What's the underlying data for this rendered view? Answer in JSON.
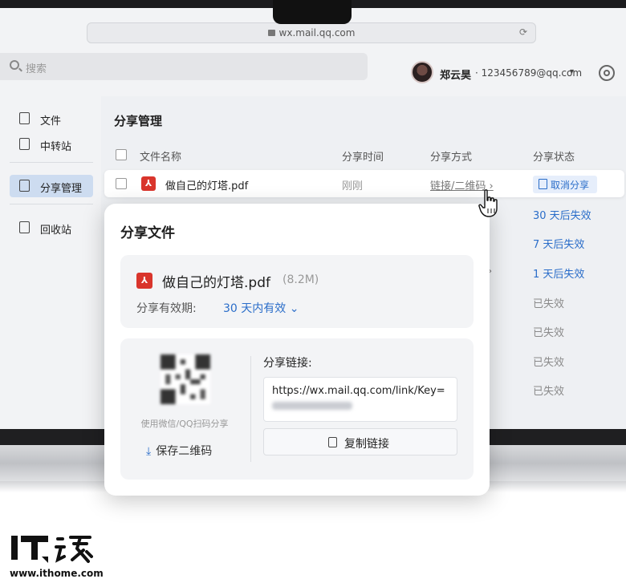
{
  "browser": {
    "url": "wx.mail.qq.com"
  },
  "topbar": {
    "search_placeholder": "搜索",
    "user_name": "郑云昊",
    "user_email": "· 123456789@qq.com",
    "user_caret": "▾"
  },
  "sidebar": {
    "items": [
      {
        "label": "文件",
        "icon": "file-icon"
      },
      {
        "label": "中转站",
        "icon": "transfer-icon"
      },
      {
        "label": "分享管理",
        "icon": "share-icon",
        "active": true
      },
      {
        "label": "回收站",
        "icon": "trash-icon"
      }
    ]
  },
  "main": {
    "title": "分享管理",
    "columns": [
      "文件名称",
      "分享时间",
      "分享方式",
      "分享状态"
    ],
    "rows": [
      {
        "name": "做自己的灯塔.pdf",
        "time": "刚刚",
        "method": "链接/二维码 ›",
        "status": "取消分享"
      }
    ],
    "statuses": [
      "30 天后失效",
      "7 天后失效",
      "1 天后失效",
      "已失效",
      "已失效",
      "已失效",
      "已失效"
    ],
    "partial_chevron": "›"
  },
  "popup": {
    "title": "分享文件",
    "file_name": "做自己的灯塔.pdf",
    "file_size": "(8.2M)",
    "validity_label": "分享有效期:",
    "validity_value": "30 天内有效 ⌄",
    "qr_caption": "使用微信/QQ扫码分享",
    "save_qr": "保存二维码",
    "link_label": "分享链接:",
    "link_text": "https://wx.mail.qq.com/link/Key=",
    "copy_label": "复制链接"
  },
  "watermark": {
    "url": "www.ithome.com"
  },
  "colors": {
    "accent": "#2a6dc9",
    "pdf_red": "#d9352c",
    "active_bg": "#cddcf0"
  }
}
